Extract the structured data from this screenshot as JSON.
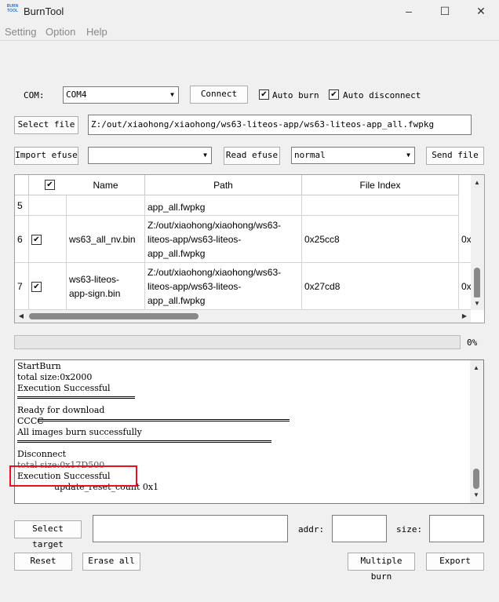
{
  "window": {
    "title": "BurnTool",
    "logo_text": "BURN TOOL",
    "minimize": "–",
    "maximize": "☐",
    "close": "✕"
  },
  "menu": [
    "Setting",
    "Option",
    "Help"
  ],
  "com": {
    "label": "COM:",
    "value": "COM4",
    "connect_label": "Connect",
    "auto_burn_label": "Auto burn",
    "auto_burn_checked": true,
    "auto_disconnect_label": "Auto disconnect",
    "auto_disconnect_checked": true
  },
  "file": {
    "select_label": "Select file",
    "path": "Z:/out/xiaohong/xiaohong/ws63-liteos-app/ws63-liteos-app_all.fwpkg"
  },
  "efuse": {
    "import_label": "Import efuse",
    "value": "",
    "read_label": "Read efuse",
    "mode_value": "normal",
    "send_label": "Send file"
  },
  "table": {
    "headers": [
      "",
      "Name",
      "Path",
      "File Index"
    ],
    "partial_row": {
      "index": "5",
      "name": "",
      "path": "app_all.fwpkg"
    },
    "rows": [
      {
        "index": "6",
        "checked": true,
        "name": "ws63_all_nv.bin",
        "path": "Z:/out/xiaohong/xiaohong/ws63-\nliteos-app/ws63-liteos-\napp_all.fwpkg",
        "file_index": "0x25cc8",
        "extra": "0x"
      },
      {
        "index": "7",
        "checked": true,
        "name": "ws63-liteos-\napp-sign.bin",
        "path": "Z:/out/xiaohong/xiaohong/ws63-\nliteos-app/ws63-liteos-\napp_all.fwpkg",
        "file_index": "0x27cd8",
        "extra": "0x"
      }
    ]
  },
  "progress": {
    "value": 0,
    "text": "0%"
  },
  "log": {
    "lines": [
      "StartBurn",
      "total size:0x2000",
      "Execution Successful",
      "Ready for download",
      "CCCC",
      "All images burn successfully",
      "Disconnect",
      "total size:0x17D500",
      "Execution Successful",
      "update_reset_count 0x1"
    ]
  },
  "target": {
    "select_label": "Select target",
    "value": "",
    "addr_label": "addr:",
    "addr_value": "",
    "size_label": "size:",
    "size_value": ""
  },
  "bottom": {
    "reset_label": "Reset",
    "erase_label": "Erase all",
    "multiple_label": "Multiple burn",
    "export_label": "Export"
  },
  "colors": {
    "highlight": "#e81123",
    "background": "#f0f0f0",
    "progress_fill": "#06b025"
  }
}
